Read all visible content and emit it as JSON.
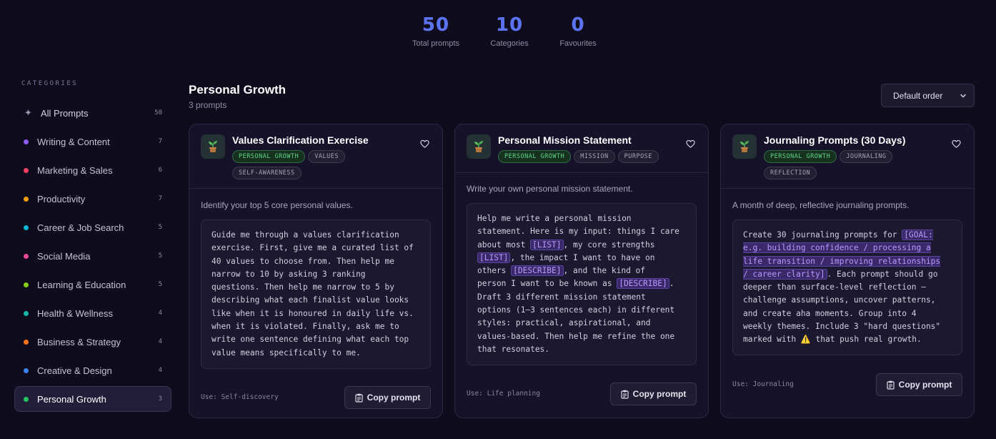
{
  "stats": [
    {
      "value": "50",
      "label": "Total prompts"
    },
    {
      "value": "10",
      "label": "Categories"
    },
    {
      "value": "0",
      "label": "Favourites"
    }
  ],
  "sidebar": {
    "heading": "CATEGORIES",
    "all": {
      "label": "All Prompts",
      "count": "50"
    },
    "items": [
      {
        "label": "Writing & Content",
        "count": "7",
        "color": "#8b5cf6"
      },
      {
        "label": "Marketing & Sales",
        "count": "6",
        "color": "#f43f5e"
      },
      {
        "label": "Productivity",
        "count": "7",
        "color": "#f59e0b"
      },
      {
        "label": "Career & Job Search",
        "count": "5",
        "color": "#06b6d4"
      },
      {
        "label": "Social Media",
        "count": "5",
        "color": "#ec4899"
      },
      {
        "label": "Learning & Education",
        "count": "5",
        "color": "#84cc16"
      },
      {
        "label": "Health & Wellness",
        "count": "4",
        "color": "#14b8a6"
      },
      {
        "label": "Business & Strategy",
        "count": "4",
        "color": "#f97316"
      },
      {
        "label": "Creative & Design",
        "count": "4",
        "color": "#3b82f6"
      },
      {
        "label": "Personal Growth",
        "count": "3",
        "color": "#22c55e"
      }
    ]
  },
  "main": {
    "title": "Personal Growth",
    "subtitle": "3 prompts",
    "sort_label": "Default order"
  },
  "cards": [
    {
      "title": "Values Clarification Exercise",
      "icon": "seedling-icon",
      "tags": [
        "PERSONAL GROWTH",
        "VALUES",
        "SELF-AWARENESS"
      ],
      "description": "Identify your top 5 core personal values.",
      "prompt_lines": [
        "Guide me through a values clarification",
        "exercise. First, give me a curated list of",
        "40 values to choose from. Then help me",
        "narrow to 10 by asking 3 ranking",
        "questions. Then help me narrow to 5 by",
        "describing what each finalist value looks",
        "like when it is honoured in daily life vs.",
        "when it is violated. Finally, ask me to",
        "write one sentence defining what each top",
        "value means specifically to me."
      ],
      "use": "Use: Self-discovery",
      "copy_label": "Copy prompt"
    },
    {
      "title": "Personal Mission Statement",
      "icon": "seedling-icon",
      "tags": [
        "PERSONAL GROWTH",
        "MISSION",
        "PURPOSE"
      ],
      "description": "Write your own personal mission statement.",
      "prompt_segments": [
        "Help me write a personal mission\nstatement. Here is my input: things I care\nabout most ",
        "[LIST]",
        ", my core strengths\n",
        "[LIST]",
        ", the impact I want to have on\nothers ",
        "[DESCRIBE]",
        ", and the kind of\nperson I want to be known as ",
        "[DESCRIBE]",
        ".\nDraft 3 different mission statement\noptions (1–3 sentences each) in different\nstyles: practical, aspirational, and\nvalues-based. Then help me refine the one\nthat resonates."
      ],
      "use": "Use: Life planning",
      "copy_label": "Copy prompt"
    },
    {
      "title": "Journaling Prompts (30 Days)",
      "icon": "seedling-icon",
      "tags": [
        "PERSONAL GROWTH",
        "JOURNALING",
        "REFLECTION"
      ],
      "description": "A month of deep, reflective journaling prompts.",
      "prompt_segments": [
        "Create 30 journaling prompts for ",
        "[GOAL:\ne.g. building confidence / processing a\nlife transition / improving relationships\n/ career clarity]",
        ". Each prompt should go\ndeeper than surface-level reflection —\nchallenge assumptions, uncover patterns,\nand create aha moments. Group into 4\nweekly themes. Include 3 \"hard questions\"\nmarked with ",
        "⚠️",
        " that push real growth."
      ],
      "use": "Use: Journaling",
      "copy_label": "Copy prompt"
    }
  ],
  "colors": {
    "background": "#0f0c1d",
    "accent": "#5b73f0",
    "placeholder": "#b49aff",
    "tag_green": "#5fd48a"
  }
}
